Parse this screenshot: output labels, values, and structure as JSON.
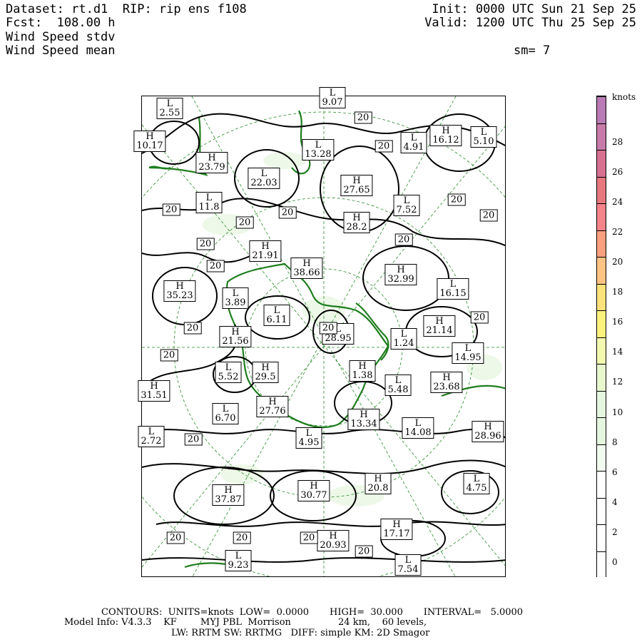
{
  "header": {
    "dataset": "Dataset: rt.d1  RIP: rip ens f108",
    "fcst": "Fcst:  108.00 h",
    "field1": "Wind Speed stdv",
    "field2": "Wind Speed mean",
    "init": "Init: 0000 UTC Sun 21 Sep 25",
    "valid": "Valid: 1200 UTC Thu 25 Sep 25",
    "smooth": "sm= 7"
  },
  "colorbar": {
    "units": "knots",
    "ticks": [
      "0",
      "2",
      "4",
      "6",
      "8",
      "10",
      "12",
      "14",
      "16",
      "18",
      "20",
      "22",
      "24",
      "26",
      "28"
    ],
    "colors": [
      "#ffffff",
      "#ffffff",
      "#ffffff",
      "#ffffff",
      "#f2fbf0",
      "#e6f7e0",
      "#e6f7e0",
      "#e9f7cf",
      "#f3fab0",
      "#fbf27e",
      "#fbe27a",
      "#fcc383",
      "#fba07f",
      "#f5838a",
      "#e6787e",
      "#d87092",
      "#c77aa9",
      "#b97ab5"
    ]
  },
  "map": {
    "highs_lows": [
      {
        "k": "L",
        "v": "2.55"
      },
      {
        "k": "H",
        "v": "10.17"
      },
      {
        "k": "H",
        "v": "23.79"
      },
      {
        "k": "L",
        "v": "9.07"
      },
      {
        "k": "L",
        "v": "13.28"
      },
      {
        "k": "L",
        "v": "22.03"
      },
      {
        "k": "H",
        "v": "27.65"
      },
      {
        "k": "L",
        "v": "4.91"
      },
      {
        "k": "H",
        "v": "16.12"
      },
      {
        "k": "L",
        "v": "5.10"
      },
      {
        "k": "L",
        "v": "11.8"
      },
      {
        "k": "L",
        "v": "7.52"
      },
      {
        "k": "H",
        "v": "28.2"
      },
      {
        "k": "H",
        "v": "21.91"
      },
      {
        "k": "H",
        "v": "38.66"
      },
      {
        "k": "H",
        "v": "32.99"
      },
      {
        "k": "H",
        "v": "35.23"
      },
      {
        "k": "L",
        "v": "3.89"
      },
      {
        "k": "L",
        "v": "6.11"
      },
      {
        "k": "L",
        "v": "16.15"
      },
      {
        "k": "H",
        "v": "21.14"
      },
      {
        "k": "H",
        "v": "21.56"
      },
      {
        "k": "L",
        "v": "28.95"
      },
      {
        "k": "L",
        "v": "1.24"
      },
      {
        "k": "L",
        "v": "14.95"
      },
      {
        "k": "L",
        "v": "5.52"
      },
      {
        "k": "H",
        "v": "29.5"
      },
      {
        "k": "H",
        "v": "1.38"
      },
      {
        "k": "L",
        "v": "5.48"
      },
      {
        "k": "H",
        "v": "23.68"
      },
      {
        "k": "H",
        "v": "31.51"
      },
      {
        "k": "L",
        "v": "6.70"
      },
      {
        "k": "H",
        "v": "27.76"
      },
      {
        "k": "H",
        "v": "13.34"
      },
      {
        "k": "L",
        "v": "14.08"
      },
      {
        "k": "H",
        "v": "28.96"
      },
      {
        "k": "L",
        "v": "2.72"
      },
      {
        "k": "L",
        "v": "4.95"
      },
      {
        "k": "H",
        "v": "20.8"
      },
      {
        "k": "L",
        "v": "4.75"
      },
      {
        "k": "H",
        "v": "37.87"
      },
      {
        "k": "H",
        "v": "30.77"
      },
      {
        "k": "H",
        "v": "17.17"
      },
      {
        "k": "H",
        "v": "20.93"
      },
      {
        "k": "L",
        "v": "9.23"
      },
      {
        "k": "L",
        "v": "7.54"
      }
    ],
    "contour_labels": [
      "20",
      "20",
      "20",
      "20",
      "20",
      "20",
      "20",
      "20",
      "20",
      "20",
      "20",
      "20",
      "20",
      "20",
      "20",
      "20",
      "20",
      "20",
      "20"
    ]
  },
  "footer": {
    "line1": "CONTOURS:  UNITS=knots  LOW=  0.0000       HIGH=  30.000       INTERVAL=   5.0000",
    "line2": "Model Info: V4.3.3    KF        MYJ PBL  Morrison                24 km,    60 levels,",
    "line3": "LW: RRTM SW: RRTMG   DIFF: simple KM: 2D Smagor"
  }
}
